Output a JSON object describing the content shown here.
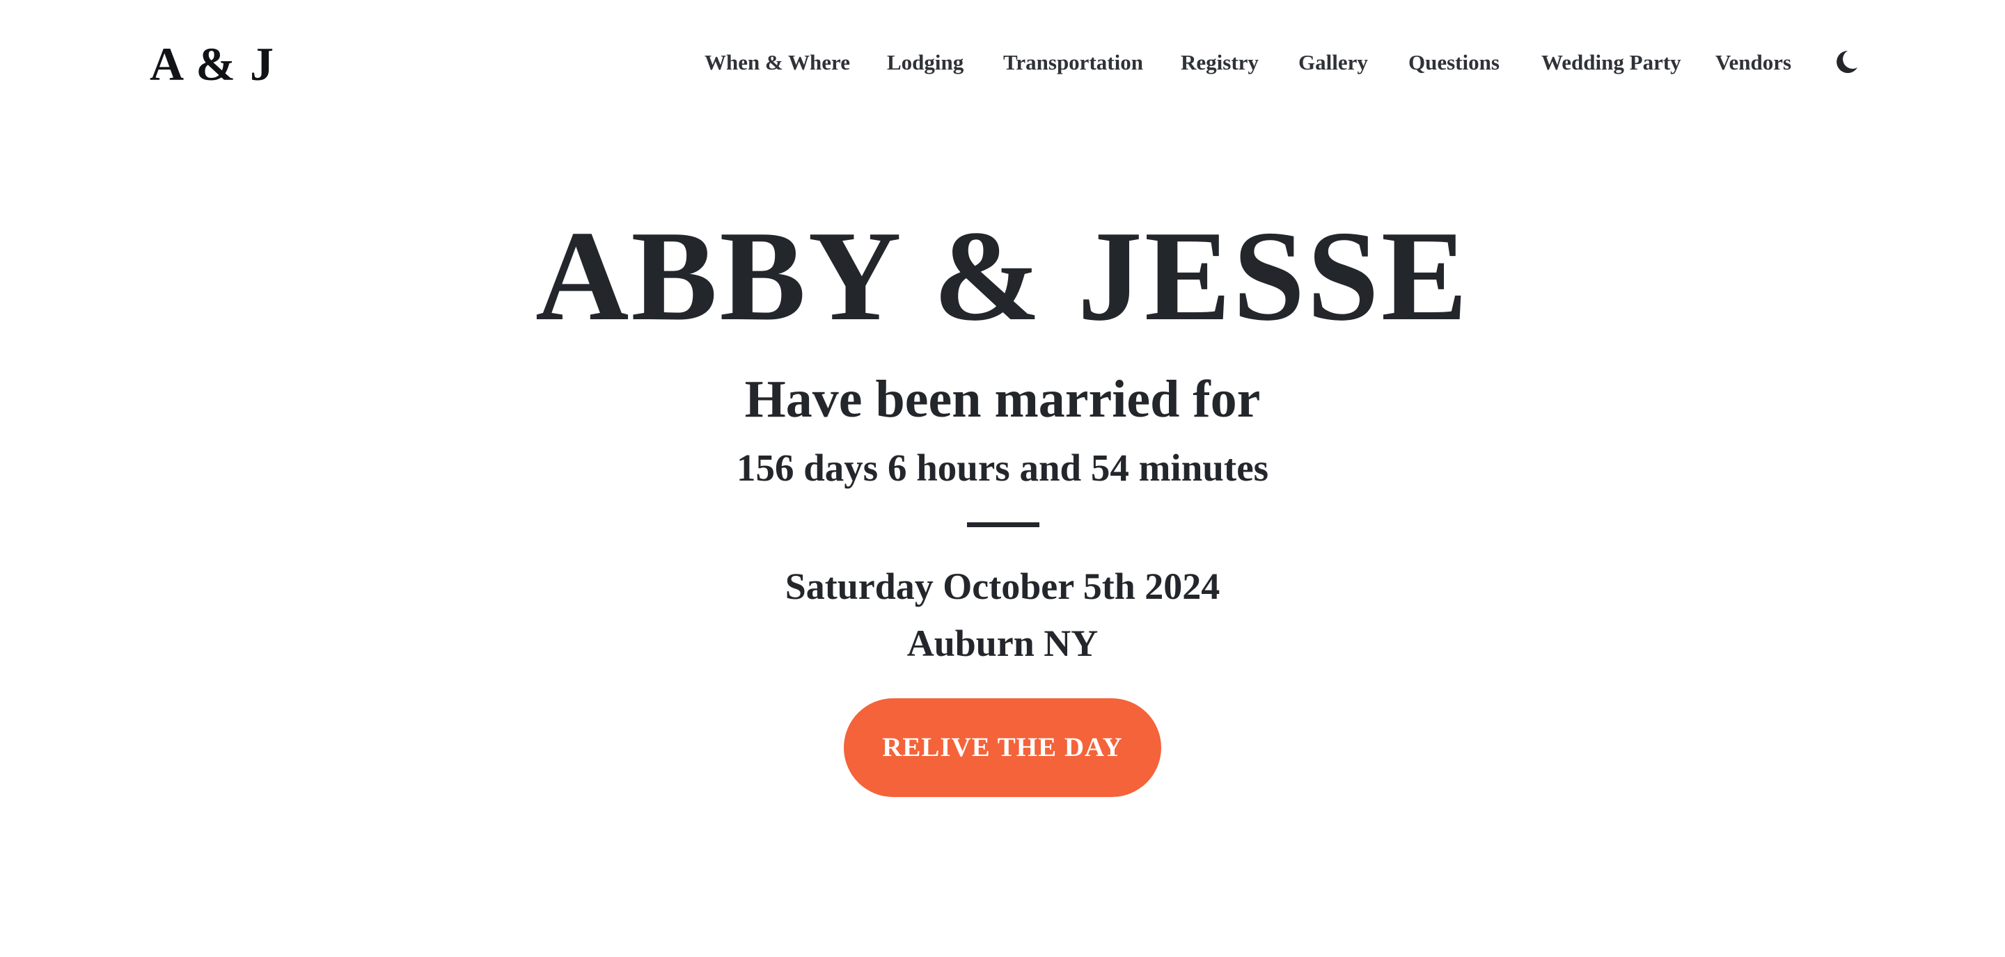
{
  "header": {
    "logo": "A & J",
    "nav": [
      {
        "label": "When & Where"
      },
      {
        "label": "Lodging"
      },
      {
        "label": "Transportation"
      },
      {
        "label": "Registry"
      },
      {
        "label": "Gallery"
      },
      {
        "label": "Questions"
      },
      {
        "label": "Wedding Party"
      },
      {
        "label": "Vendors"
      }
    ],
    "theme_toggle_icon": "moon-icon"
  },
  "hero": {
    "title": "ABBY & JESSE",
    "subtitle": "Have been married for",
    "countdown": "156 days 6 hours and 54 minutes",
    "date": "Saturday October 5th 2024",
    "location": "Auburn NY",
    "cta_label": "RELIVE THE DAY"
  },
  "colors": {
    "text": "#23262b",
    "accent": "#f4633a",
    "background": "#ffffff"
  }
}
